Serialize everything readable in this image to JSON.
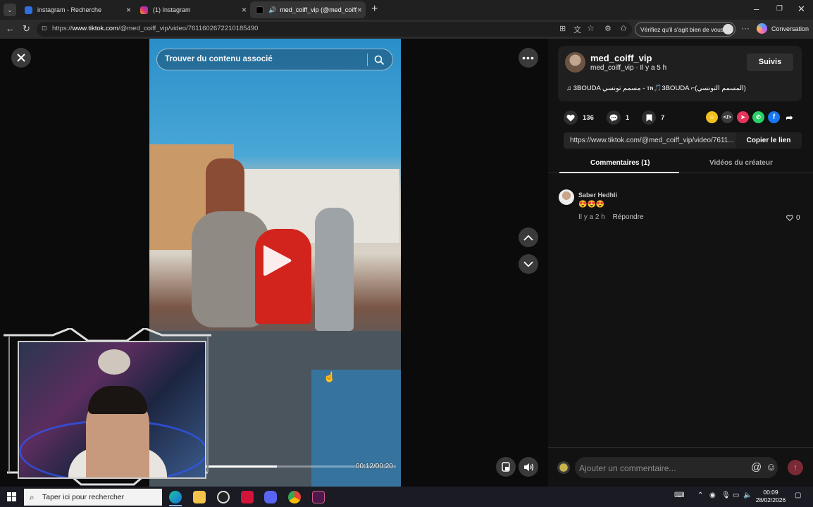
{
  "browser": {
    "tabs": [
      {
        "label": "instagram - Recherche",
        "favicon_color": "#2f6fde",
        "active": false
      },
      {
        "label": "(1) Instagram",
        "favicon_color": "#d62e7f",
        "active": false
      },
      {
        "label": "med_coiff_vip (@med_coiff_vi",
        "favicon_color": "#000000",
        "active": true
      }
    ],
    "new_tab_label": "+",
    "url_prefix": "https://",
    "url_domain": "www.tiktok.com",
    "url_path": "/@med_coiff_vip/video/7611602672210185490",
    "verify_label": "Vérifiez qu'il s'agit bien de vous",
    "copilot_label": "Conversation"
  },
  "video": {
    "search_placeholder": "Trouver du contenu associé",
    "time_label": "00:12/00:20",
    "progress_fraction": 0.375
  },
  "author": {
    "username": "med_coiff_vip",
    "subline": "med_coiff_vip · Il y a 5 h",
    "follow_label": "Suivis",
    "music_line": "♫  3BOUDA مسمم تونسي - ᴛɴ🎵3BOUDA ⌐(المسمم التونسي)"
  },
  "stats": {
    "likes": "136",
    "comments": "1",
    "saves": "7"
  },
  "share_colors": [
    "#f2c01e",
    "#3a3a3a",
    "#e7355a",
    "#25d366",
    "#1877f2"
  ],
  "link": {
    "url": "https://www.tiktok.com/@med_coiff_vip/video/7611...",
    "copy_label": "Copier le lien"
  },
  "panel_tabs": {
    "comments": "Commentaires (1)",
    "creator_videos": "Vidéos du créateur"
  },
  "comment": {
    "author": "Saber Hedhli",
    "body": "😍😍😍",
    "time": "Il y a 2 h",
    "reply_label": "Répondre",
    "likes": "0"
  },
  "compose": {
    "placeholder": "Ajouter un commentaire...",
    "at": "@",
    "emoji": "☺"
  },
  "taskbar": {
    "search_label": "Taper ici pour rechercher",
    "time": "00:09",
    "date": "28/02/2026"
  }
}
